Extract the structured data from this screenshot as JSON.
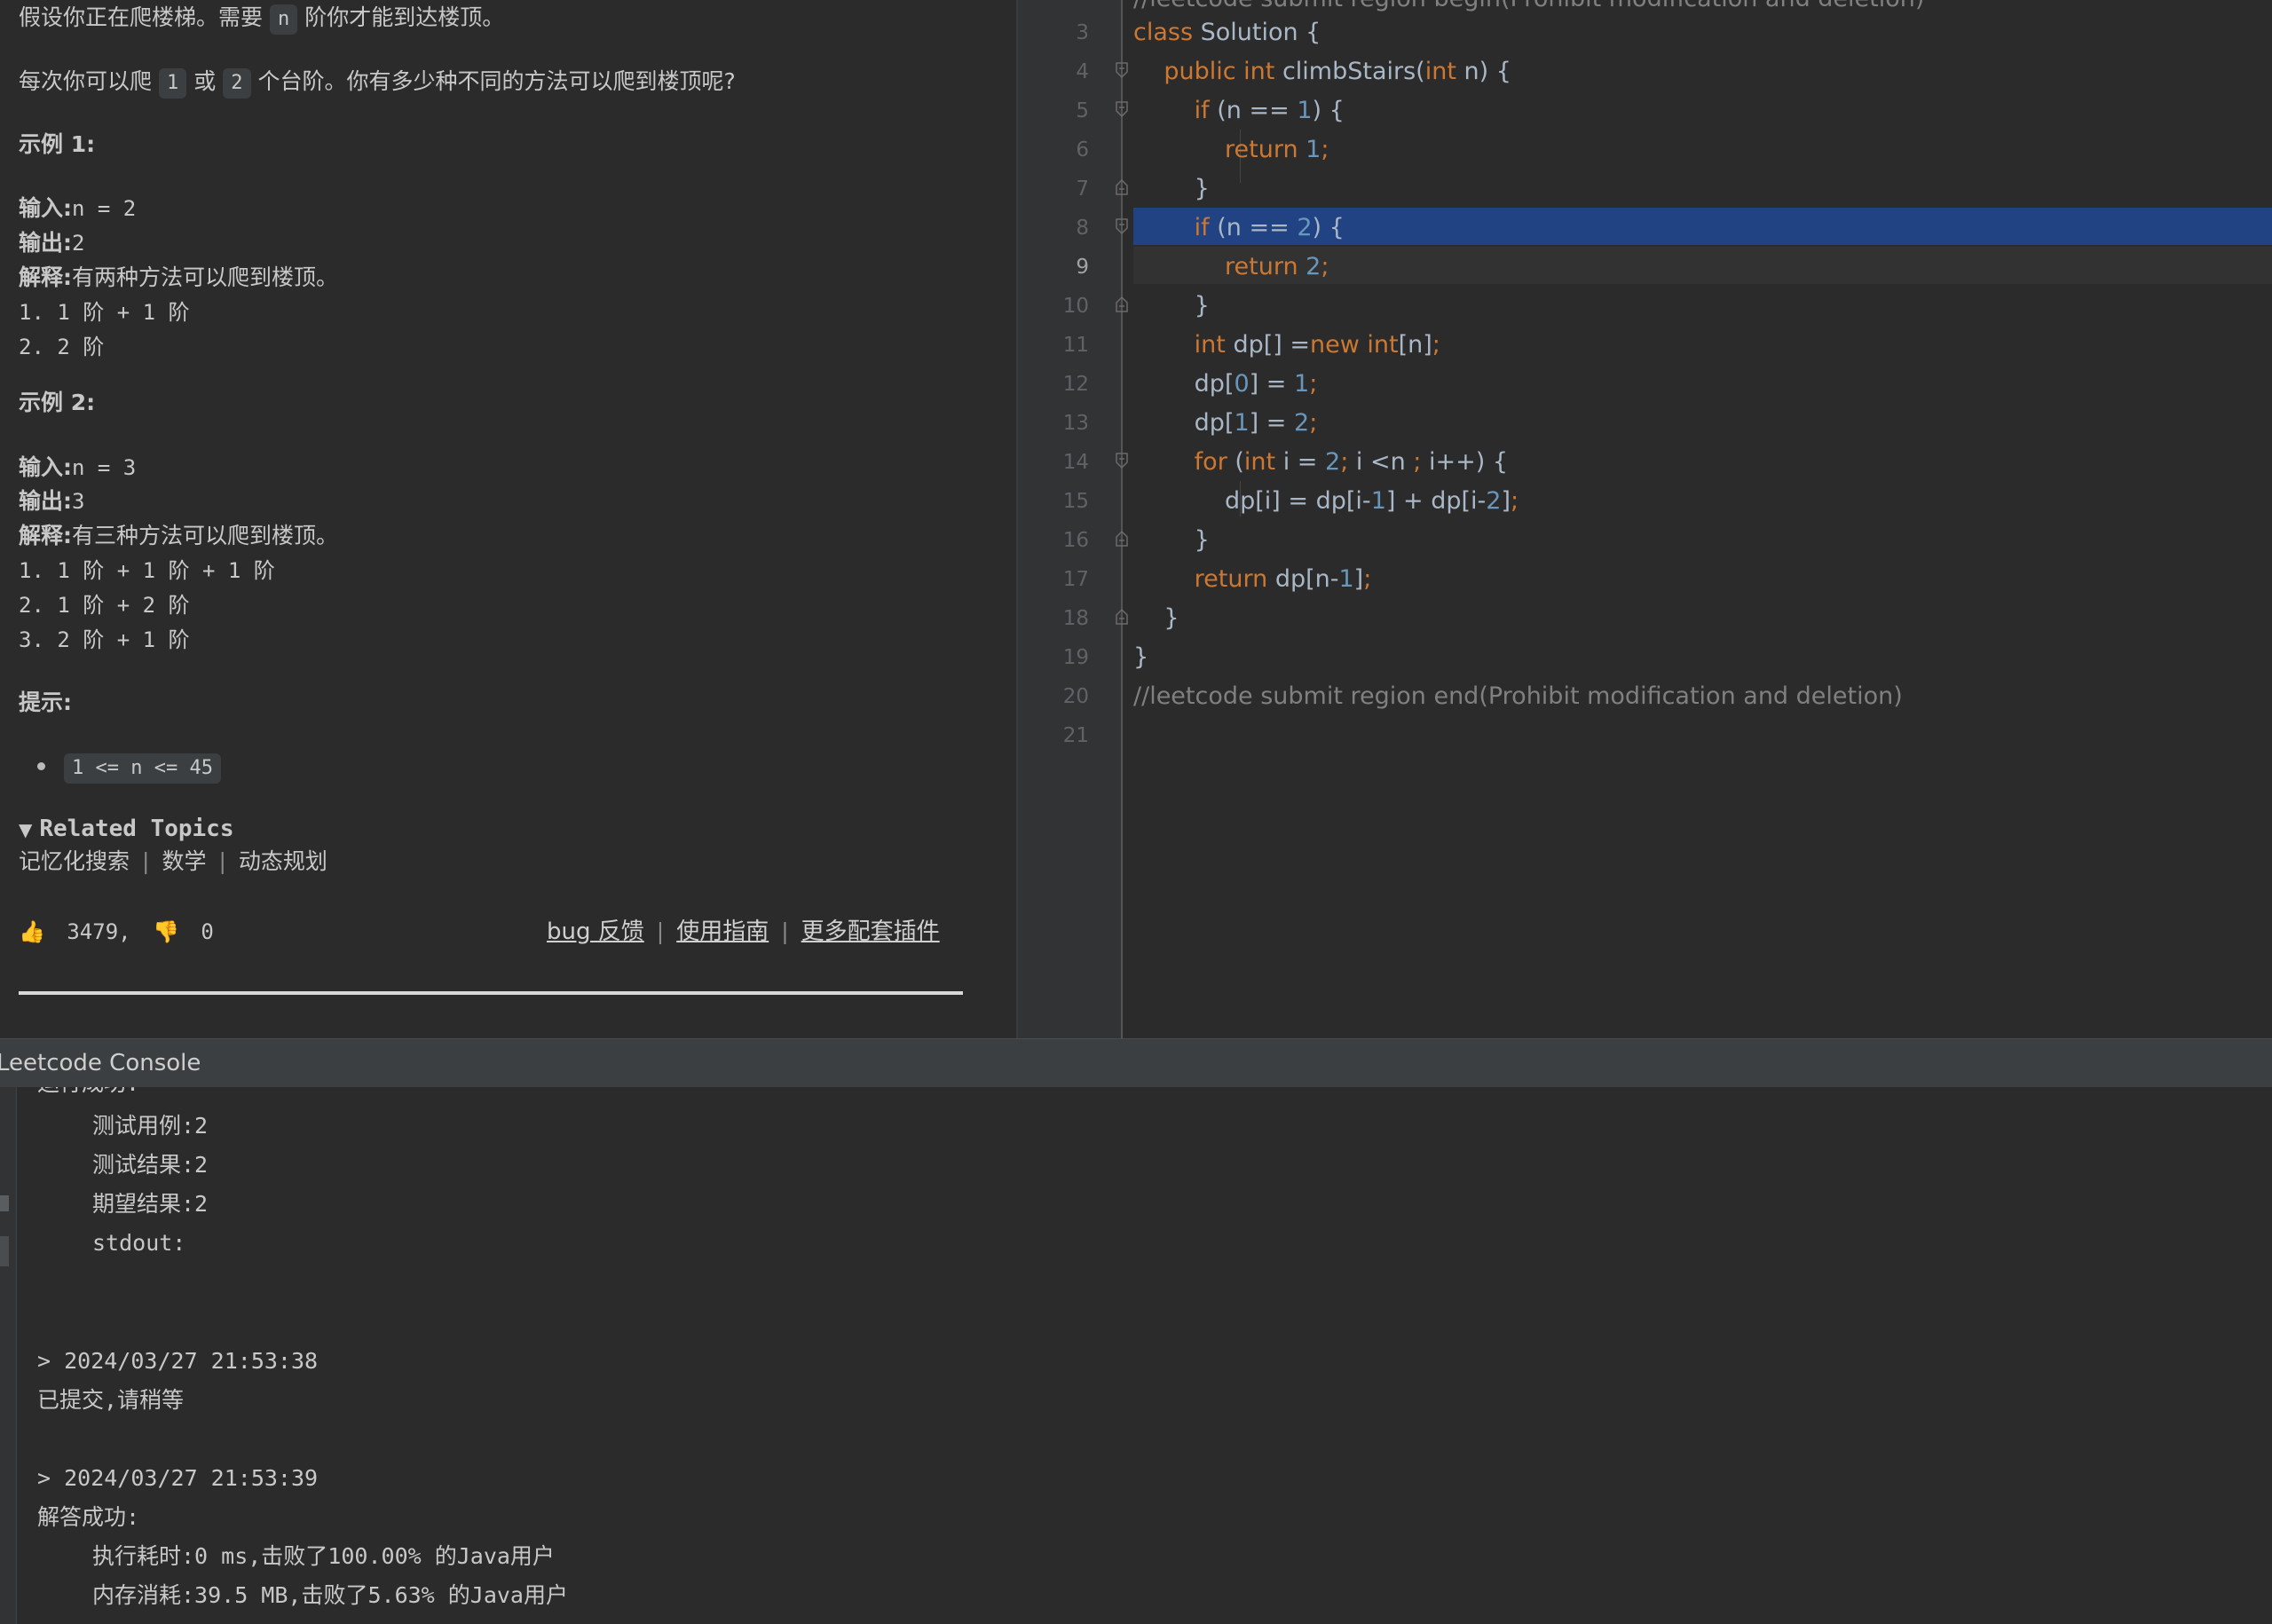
{
  "description": {
    "intro_prefix": "假设你正在爬楼梯。需要",
    "intro_var": "n",
    "intro_suffix": "阶你才能到达楼顶。",
    "rule_prefix": "每次你可以爬",
    "rule_step1": "1",
    "rule_or": "或",
    "rule_step2": "2",
    "rule_suffix": "个台阶。你有多少种不同的方法可以爬到楼顶呢?",
    "example1": {
      "title": "示例 1:",
      "input_label": "输入:",
      "input_value": "n = 2",
      "output_label": "输出:",
      "output_value": "2",
      "explain_label": "解释:",
      "explain_text": "有两种方法可以爬到楼顶。",
      "steps": [
        "1. 1 阶 + 1 阶",
        "2. 2 阶"
      ]
    },
    "example2": {
      "title": "示例 2:",
      "input_label": "输入:",
      "input_value": "n = 3",
      "output_label": "输出:",
      "output_value": "3",
      "explain_label": "解释:",
      "explain_text": "有三种方法可以爬到楼顶。",
      "steps": [
        "1. 1 阶 + 1 阶 + 1 阶",
        "2. 1 阶 + 2 阶",
        "3. 2 阶 + 1 阶"
      ]
    },
    "hint_title": "提示:",
    "hint_constraint": "1 <= n <= 45",
    "related_topics_label": "Related Topics",
    "topics": [
      "记忆化搜索",
      "数学",
      "动态规划"
    ],
    "likes": "3479,",
    "dislikes": "0",
    "links": [
      "bug 反馈",
      "使用指南",
      "更多配套插件"
    ]
  },
  "editor": {
    "line_numbers": [
      "3",
      "4",
      "5",
      "6",
      "7",
      "8",
      "9",
      "10",
      "11",
      "12",
      "13",
      "14",
      "15",
      "16",
      "17",
      "18",
      "19",
      "20",
      "21"
    ],
    "current_line": "9",
    "top_comment_partial": "//leetcode submit region begin(Prohibit modification and deletion)",
    "end_comment": "//leetcode submit region end(Prohibit modification and deletion)"
  },
  "console": {
    "title": "Leetcode Console",
    "lines": [
      {
        "text": "运行成功:",
        "indent": false
      },
      {
        "text": "测试用例:2",
        "indent": true
      },
      {
        "text": "测试结果:2",
        "indent": true
      },
      {
        "text": "期望结果:2",
        "indent": true
      },
      {
        "text": "stdout:",
        "indent": true
      },
      {
        "text": "> 2024/03/27 21:53:38",
        "indent": false
      },
      {
        "text": "已提交,请稍等",
        "indent": false
      },
      {
        "text": "> 2024/03/27 21:53:39",
        "indent": false
      },
      {
        "text": "解答成功:",
        "indent": false
      },
      {
        "text": "执行耗时:0 ms,击败了100.00% 的Java用户",
        "indent": true
      },
      {
        "text": "内存消耗:39.5 MB,击败了5.63% 的Java用户",
        "indent": true
      }
    ]
  },
  "colors": {
    "background": "#2b2b2b",
    "keyword": "#cc7832",
    "number": "#6897bb",
    "identifier": "#a9b7c6",
    "comment": "#808080",
    "selection": "#214283"
  }
}
